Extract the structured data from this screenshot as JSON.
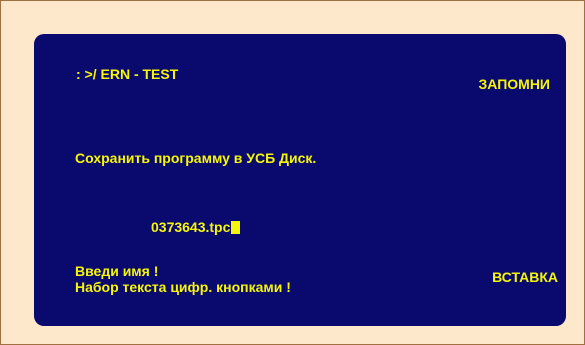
{
  "screen": {
    "path": ": >/ ERN - TEST",
    "softkey_top": "ЗАПОМНИ",
    "message": "Сохранить программу в УСБ Диск.",
    "input_value": "0373643.tpc",
    "prompt_line1": "Введи имя  !",
    "prompt_line2": "Набор текста цифр. кнопками  !",
    "softkey_bottom": "ВСТАВКА"
  },
  "colors": {
    "background": "#fde8cc",
    "panel": "#0a0a6e",
    "text": "#f5f50a"
  }
}
